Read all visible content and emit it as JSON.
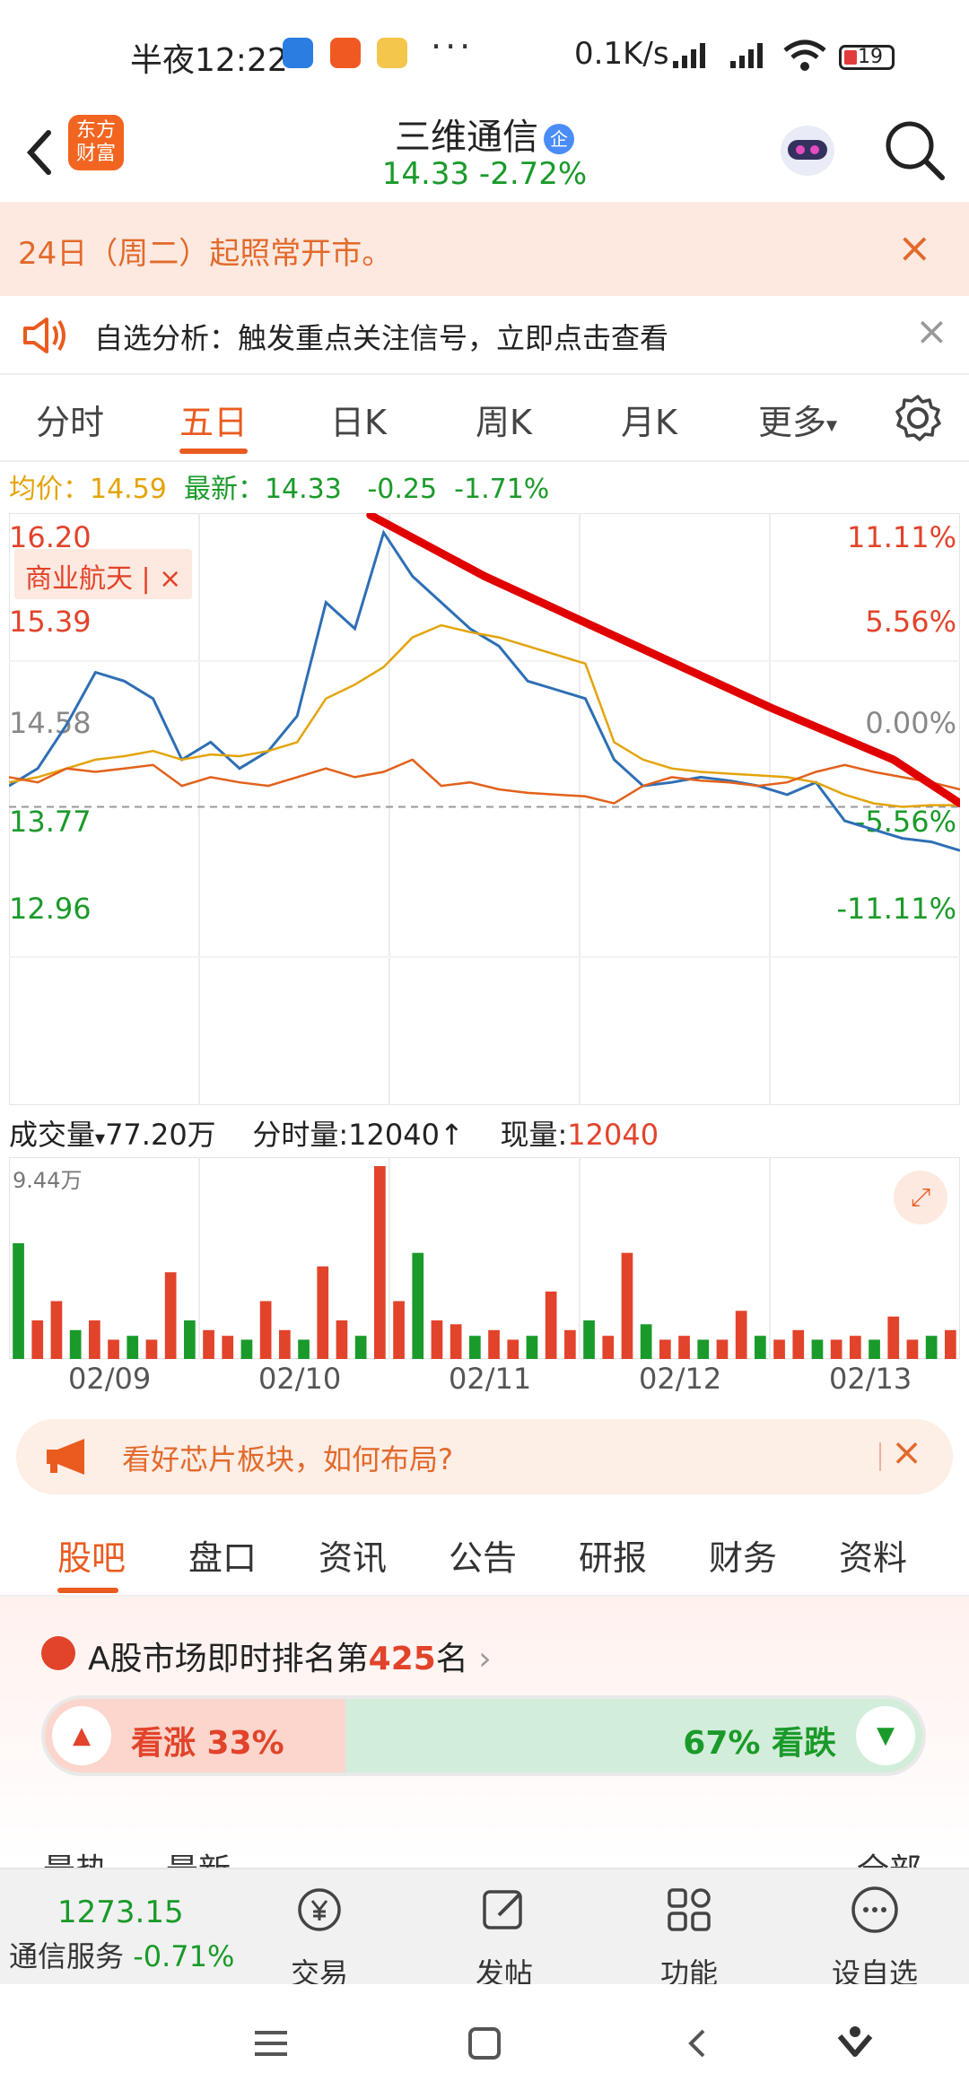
{
  "status": {
    "time": "半夜12:22",
    "more": "···",
    "network": "0.1K/s",
    "battery": "19"
  },
  "header": {
    "logo": "东方\n财富",
    "stock_name": "三维通信",
    "badge": "企",
    "price": "14.33   -2.72%"
  },
  "notice": {
    "text": "24日（周二）起照常开市。",
    "close": "×"
  },
  "alert": {
    "text": "自选分析：触发重点关注信号，立即点击查看",
    "close": "×"
  },
  "chart_tabs": {
    "items": [
      "分时",
      "五日",
      "日K",
      "周K",
      "月K",
      "更多"
    ],
    "active": "五日",
    "more_caret": "▾"
  },
  "legend": {
    "avg_label": "均价：",
    "avg": "14.59",
    "latest_label": "最新：",
    "latest": "14.33",
    "change": "-0.25",
    "pct": "-1.71%"
  },
  "concept_tag": "商业航天 | ×",
  "volume": {
    "label": "成交量",
    "caret": "▾",
    "total": "77.20万",
    "tick_label": "分时量:12040↑",
    "current_label": "现量:",
    "current": "12040",
    "max_tick": "9.44万"
  },
  "promo": {
    "text": "看好芯片板块，如何布局?",
    "close": "×"
  },
  "news_tabs": {
    "items": [
      "股吧",
      "盘口",
      "资讯",
      "公告",
      "研报",
      "财务",
      "资料"
    ],
    "active": "股吧"
  },
  "ranking": {
    "prefix": "A股市场即时排名第",
    "rank": "425",
    "suffix": "名",
    "arrow": "›",
    "up_label": "看涨 33%",
    "down_label": "67% 看跌",
    "up_pct": 33
  },
  "sort_row": {
    "hot": "最热",
    "newest": "最新",
    "all": "全部"
  },
  "toolbar": {
    "index_value": "1273.15",
    "index_name": "通信服务",
    "index_change": "-0.71%",
    "buttons": [
      "交易",
      "发帖",
      "功能",
      "设自选"
    ]
  },
  "colors": {
    "accent": "#ea5b1f",
    "up": "#e2432b",
    "down": "#1a9a2a",
    "avg_line": "#e3a40a"
  },
  "chart_data": {
    "type": "line",
    "x_labels": [
      "02/09",
      "02/10",
      "02/11",
      "02/12",
      "02/13"
    ],
    "y_ticks": [
      "16.20",
      "15.39",
      "14.58",
      "13.77",
      "12.96"
    ],
    "y_pct_ticks": [
      "11.11%",
      "5.56%",
      "0.00%",
      "-5.56%",
      "-11.11%"
    ],
    "ylim": [
      12.96,
      16.2
    ],
    "prev_close": 14.58,
    "series": [
      {
        "color": "#2e6fb5",
        "values": [
          14.7,
          14.8,
          15.05,
          15.35,
          15.3,
          15.2,
          14.85,
          14.95,
          14.8,
          14.9,
          15.1,
          15.75,
          15.6,
          16.15,
          15.9,
          15.75,
          15.6,
          15.5,
          15.3,
          15.25,
          15.2,
          14.85,
          14.7,
          14.72,
          14.75,
          14.73,
          14.7,
          14.65,
          14.72,
          14.5,
          14.45,
          14.4,
          14.38,
          14.33
        ]
      },
      {
        "color": "#e3a40a",
        "values": [
          14.72,
          14.75,
          14.8,
          14.85,
          14.87,
          14.9,
          14.85,
          14.88,
          14.87,
          14.9,
          14.95,
          15.2,
          15.28,
          15.38,
          15.55,
          15.62,
          15.58,
          15.55,
          15.5,
          15.45,
          15.4,
          14.95,
          14.85,
          14.8,
          14.78,
          14.77,
          14.76,
          14.75,
          14.72,
          14.65,
          14.6,
          14.58,
          14.59,
          14.59
        ]
      },
      {
        "color": "#e2611b",
        "values": [
          14.75,
          14.72,
          14.8,
          14.78,
          14.8,
          14.82,
          14.7,
          14.75,
          14.72,
          14.7,
          14.75,
          14.8,
          14.75,
          14.78,
          14.85,
          14.7,
          14.72,
          14.68,
          14.66,
          14.65,
          14.64,
          14.6,
          14.7,
          14.75,
          14.73,
          14.72,
          14.7,
          14.72,
          14.78,
          14.82,
          14.78,
          14.75,
          14.72,
          14.68
        ]
      }
    ],
    "annotation_line": [
      {
        "x": 0.38,
        "y": 16.25
      },
      {
        "x": 0.5,
        "y": 15.9
      },
      {
        "x": 0.62,
        "y": 15.6
      },
      {
        "x": 0.8,
        "y": 15.15
      },
      {
        "x": 0.93,
        "y": 14.85
      },
      {
        "x": 1.0,
        "y": 14.6
      }
    ],
    "volume": [
      0.6,
      0.2,
      0.3,
      0.15,
      0.2,
      0.1,
      0.12,
      0.1,
      0.45,
      0.2,
      0.15,
      0.12,
      0.1,
      0.3,
      0.15,
      0.1,
      0.48,
      0.2,
      0.12,
      1.0,
      0.3,
      0.55,
      0.2,
      0.18,
      0.12,
      0.15,
      0.1,
      0.12,
      0.35,
      0.15,
      0.2,
      0.12,
      0.55,
      0.18,
      0.1,
      0.12,
      0.1,
      0.1,
      0.25,
      0.12,
      0.1,
      0.15,
      0.1,
      0.1,
      0.12,
      0.1,
      0.22,
      0.1,
      0.12,
      0.15
    ]
  }
}
